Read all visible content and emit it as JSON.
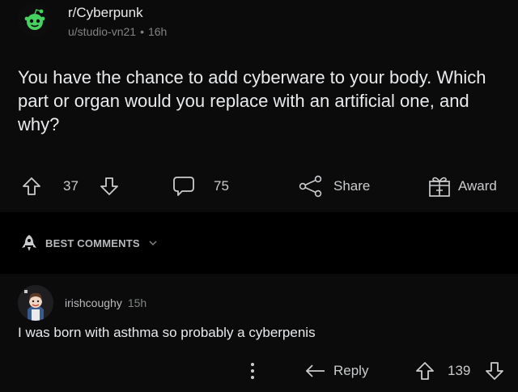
{
  "post": {
    "subreddit": "r/Cyberpunk",
    "author": "u/studio-vn21",
    "separator": "•",
    "age": "16h",
    "title": "You have the chance to add cyberware to your body. Which part or organ would you replace with an artificial one, and why?",
    "icon": "reddit-snoo-icon"
  },
  "actions": {
    "upvotes": "37",
    "comments": "75",
    "share_label": "Share",
    "award_label": "Award"
  },
  "sort": {
    "label": "BEST COMMENTS",
    "icon": "rocket-icon"
  },
  "comment": {
    "username": "irishcoughy",
    "age": "15h",
    "body": "I was born with asthma so probably a cyberpenis",
    "reply_label": "Reply",
    "votes": "139"
  },
  "colors": {
    "accent_green": "#46d160",
    "background": "#000000",
    "card": "#0b0b0c",
    "text": "#e8eaec",
    "muted": "#818384"
  }
}
